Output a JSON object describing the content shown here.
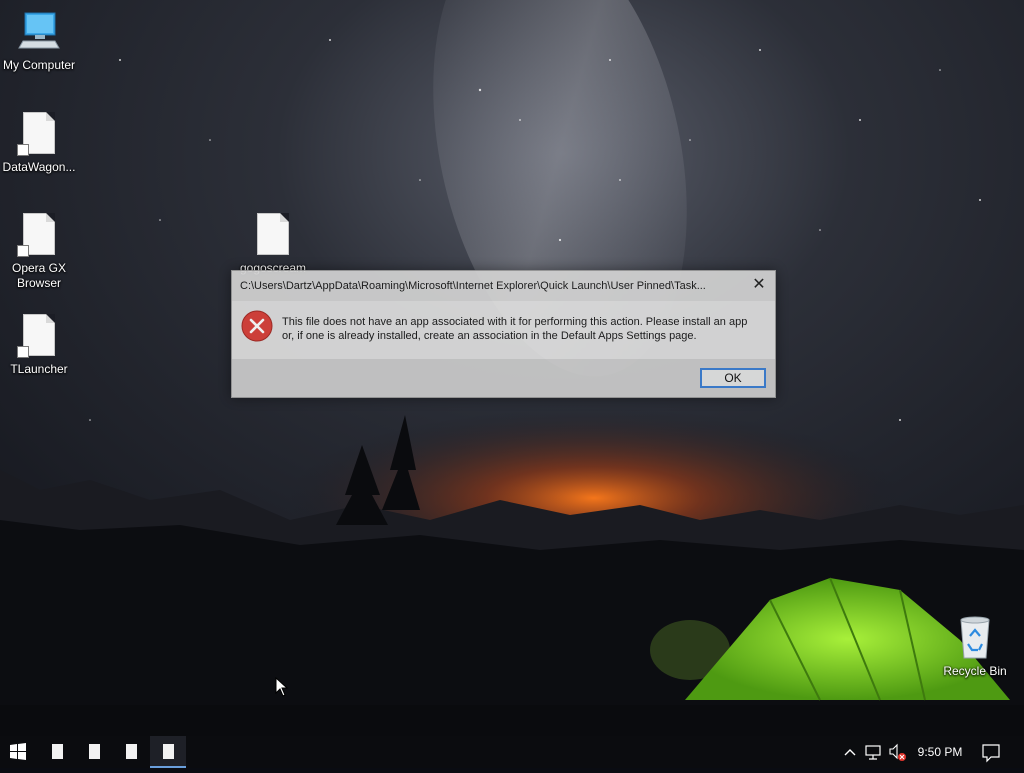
{
  "desktop": {
    "icons": [
      {
        "label": "My Computer"
      },
      {
        "label": "DataWagon..."
      },
      {
        "label": "Opera GX Browser"
      },
      {
        "label": "TLauncher"
      },
      {
        "label": "gogoscream"
      },
      {
        "label": "Recycle Bin"
      }
    ]
  },
  "dialog": {
    "title": "C:\\Users\\Dartz\\AppData\\Roaming\\Microsoft\\Internet Explorer\\Quick Launch\\User Pinned\\Task...",
    "close_glyph": "✕",
    "icon": "error-icon",
    "message": "This file does not have an app associated with it for performing this action. Please install an app or, if one is already installed, create an association in the Default Apps Settings page.",
    "ok_label": "OK"
  },
  "taskbar": {
    "start_icon": "windows-logo-icon",
    "pinned": [
      {
        "icon": "file-icon"
      },
      {
        "icon": "file-icon"
      },
      {
        "icon": "file-icon"
      },
      {
        "icon": "file-icon",
        "active": true
      }
    ],
    "tray": {
      "icons": [
        "chevron-up-icon",
        "network-icon",
        "volume-muted-icon",
        "action-center-icon"
      ],
      "time": "9:50 PM"
    }
  },
  "colors": {
    "accent": "#3c7fd4",
    "error_red": "#d9413a",
    "tent_green": "#7fd62a",
    "horizon_orange": "#ff7a1a"
  }
}
